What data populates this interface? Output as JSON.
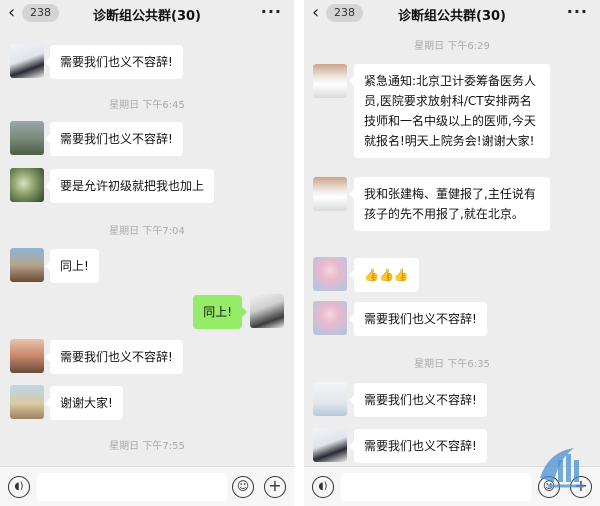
{
  "left": {
    "badge": "238",
    "title": "诊断组公共群(30)",
    "messages": [
      {
        "text": "需要我们也义不容辞!"
      },
      {
        "time": "星期日 下午6:45"
      },
      {
        "text": "需要我们也义不容辞!"
      },
      {
        "text": "要是允许初级就把我也加上"
      },
      {
        "time": "星期日 下午7:04"
      },
      {
        "text": "同上!"
      },
      {
        "text": "同上!",
        "self": true
      },
      {
        "text": "需要我们也义不容辞!"
      },
      {
        "text": "谢谢大家!"
      },
      {
        "time": "星期日 下午7:55"
      }
    ]
  },
  "right": {
    "badge": "238",
    "title": "诊断组公共群(30)",
    "messages": [
      {
        "time": "星期日 下午6:29"
      },
      {
        "text": "紧急通知:北京卫计委筹备医务人员,医院要求放射科/CT安排两名技师和一名中级以上的医师,今天就报名!明天上院务会!谢谢大家!"
      },
      {
        "text": "我和张建梅、董健报了,主任说有孩子的先不用报了,就在北京。"
      },
      {
        "text": "👍👍👍"
      },
      {
        "text": "需要我们也义不容辞!"
      },
      {
        "time": "星期日 下午6:35"
      },
      {
        "text": "需要我们也义不容辞!"
      },
      {
        "text": "需要我们也义不容辞!"
      }
    ]
  },
  "colors": {
    "background": "#ededed",
    "self_bubble": "#95ec69",
    "other_bubble": "#ffffff",
    "timestamp": "#a9a9a9"
  },
  "icons": [
    "chevron-left-icon",
    "more-icon",
    "voice-icon",
    "emoji-icon",
    "plus-icon"
  ]
}
